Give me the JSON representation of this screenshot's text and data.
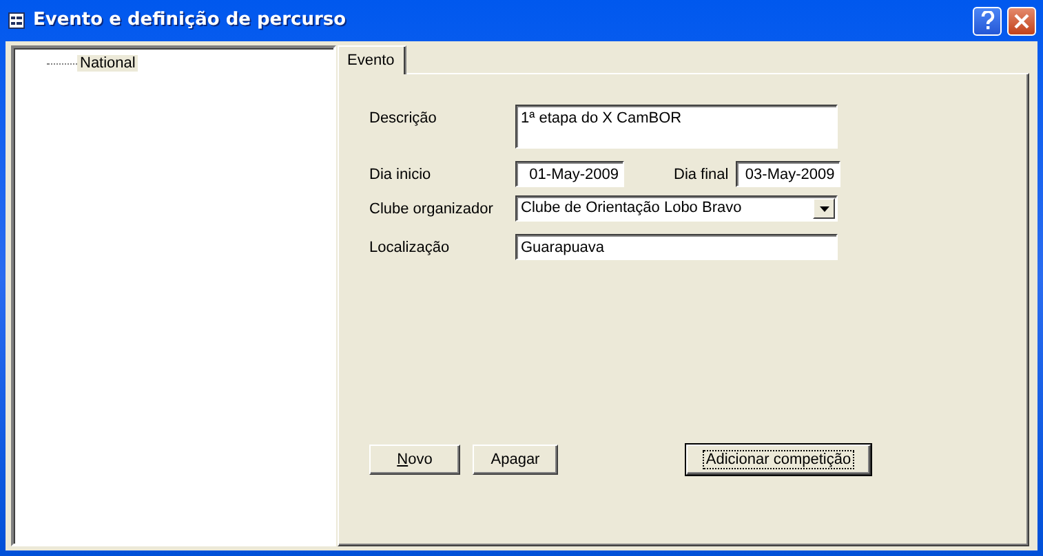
{
  "window": {
    "title": "Evento e definição de percurso"
  },
  "tree": {
    "items": [
      {
        "label": "National",
        "selected": true
      }
    ]
  },
  "tabs": [
    {
      "label": "Evento",
      "selected": true
    }
  ],
  "form": {
    "fields": [
      {
        "kind": "textarea",
        "label": "Descrição",
        "value": "1ª etapa do X CamBOR"
      },
      {
        "kind": "dates",
        "label": "Dia inicio",
        "value": "01-May-2009",
        "label_2": "Dia final",
        "value_2": "03-May-2009"
      },
      {
        "kind": "dropdown",
        "label": "Clube organizador",
        "value": "Clube de Orientação Lobo Bravo"
      },
      {
        "kind": "text",
        "label": "Localização",
        "value": "Guarapuava"
      }
    ]
  },
  "buttons": [
    {
      "label": "Novo",
      "underline_first": true,
      "default": false
    },
    {
      "label": "Apagar",
      "underline_first": false,
      "default": false
    },
    {
      "label": "Adicionar competição",
      "underline_first": false,
      "default": true
    }
  ]
}
